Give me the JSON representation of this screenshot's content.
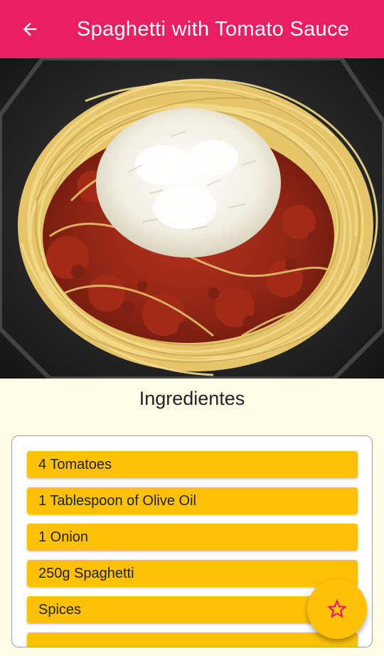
{
  "app_bar": {
    "title": "Spaghetti with Tomato Sauce",
    "back_icon": "arrow-back-icon",
    "color": "#e91e63"
  },
  "photo": {
    "subject": "spaghetti-with-tomato-sauce"
  },
  "ingredients_section": {
    "title": "Ingredientes",
    "items": [
      "4 Tomatoes",
      "1 Tablespoon of Olive Oil",
      "1 Onion",
      "250g Spaghetti",
      "Spices"
    ],
    "item_color": "#ffc107"
  },
  "fab": {
    "icon": "star-outline-icon",
    "color": "#ffc107",
    "icon_color": "#e91e63"
  },
  "background_color": "#fffde7"
}
